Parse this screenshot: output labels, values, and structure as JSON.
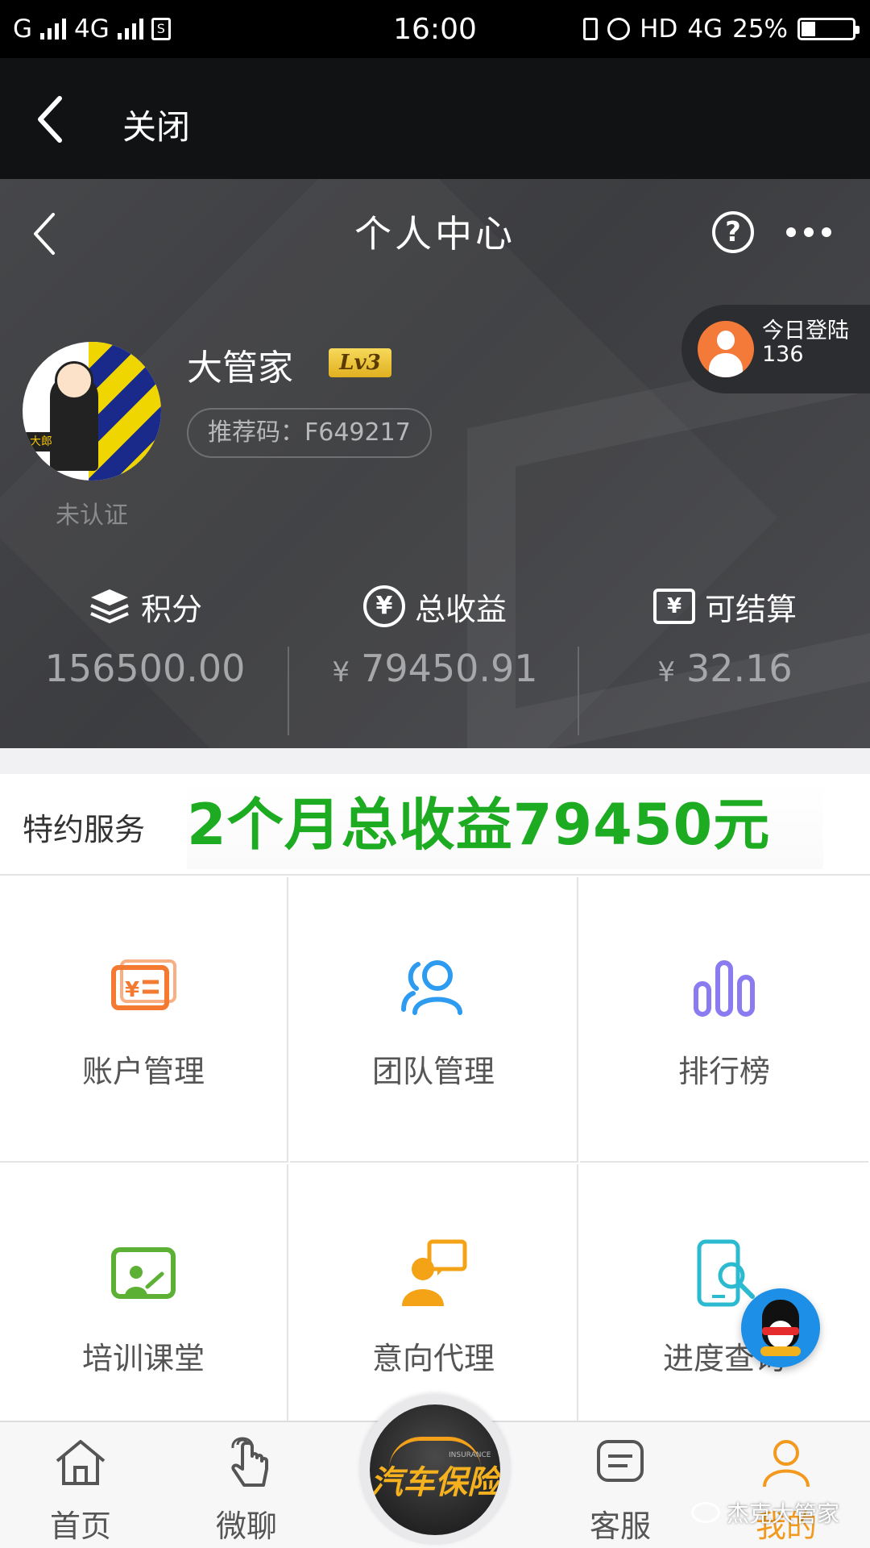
{
  "status_bar": {
    "left_carrier": "G",
    "left_network": "4G",
    "time": "16:00",
    "right_hd": "HD",
    "right_network": "4G",
    "battery_text": "25%",
    "battery_level": 0.25
  },
  "top_bar": {
    "close_label": "关闭"
  },
  "header": {
    "title": "个人中心",
    "help_glyph": "?",
    "login_today_label": "今日登陆",
    "login_today_count": "136"
  },
  "profile": {
    "name": "大管家",
    "level": "Lv3",
    "referral": "推荐码：F649217",
    "verify_status": "未认证",
    "avatar_tag": "大郎"
  },
  "stats": [
    {
      "label": "积分",
      "value": "156500.00",
      "currency": "",
      "icon": "layers-icon"
    },
    {
      "label": "总收益",
      "value": "79450.91",
      "currency": "¥",
      "icon": "yen-circle-icon"
    },
    {
      "label": "可结算",
      "value": "32.16",
      "currency": "¥",
      "icon": "wallet-icon"
    }
  ],
  "service": {
    "label": "特约服务",
    "banner": "2个月总收益79450元"
  },
  "grid": [
    {
      "label": "账户管理",
      "icon": "account-card-icon",
      "color": "#f47a32"
    },
    {
      "label": "团队管理",
      "icon": "team-icon",
      "color": "#2d9cf0"
    },
    {
      "label": "排行榜",
      "icon": "bar-chart-icon",
      "color": "#8a7cf0"
    },
    {
      "label": "培训课堂",
      "icon": "classroom-icon",
      "color": "#5cb135"
    },
    {
      "label": "意向代理",
      "icon": "agent-chat-icon",
      "color": "#f5a316"
    },
    {
      "label": "进度查询",
      "icon": "phone-search-icon",
      "color": "#2cbad0"
    }
  ],
  "tabbar": {
    "items": [
      {
        "label": "首页",
        "icon": "home-icon"
      },
      {
        "label": "微聊",
        "icon": "touch-hand-icon"
      },
      {
        "label": "客服",
        "icon": "chat-bubble-icon"
      },
      {
        "label": "我的",
        "icon": "user-icon"
      }
    ],
    "center_logo_text": "汽车保险",
    "center_logo_sub": "INSURANCE",
    "active_color": "#f39a1e"
  },
  "watermark": "杰克大管家"
}
